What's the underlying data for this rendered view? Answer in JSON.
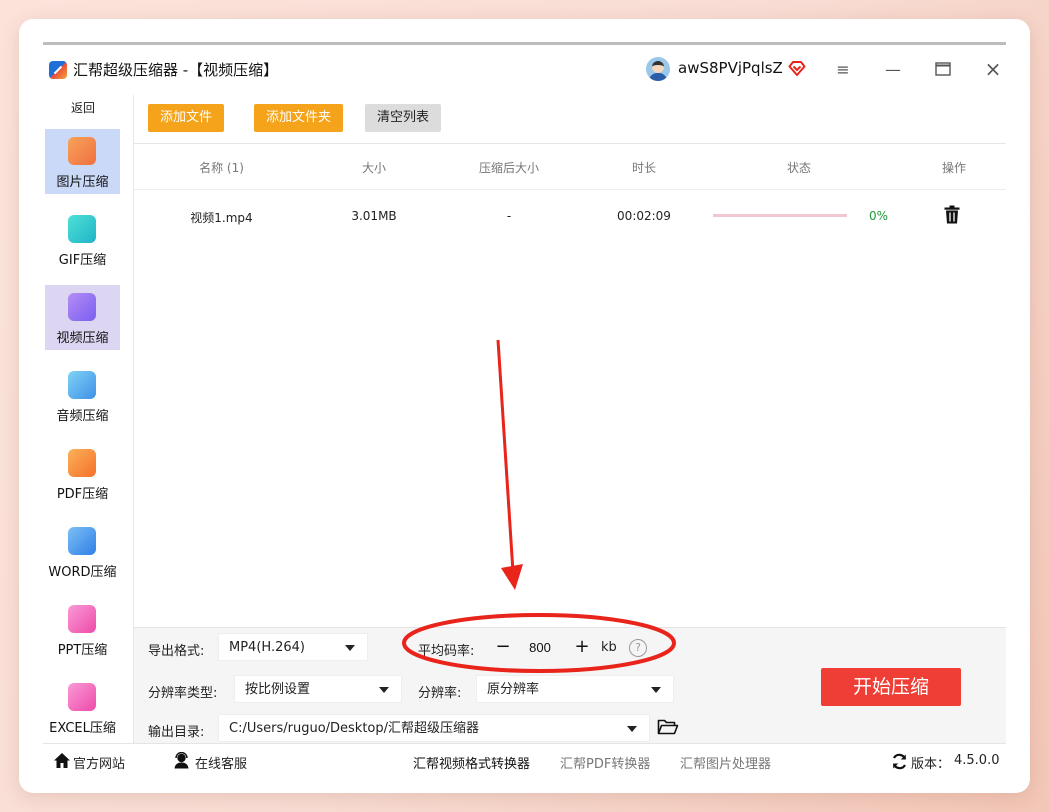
{
  "app": {
    "title": "汇帮超级压缩器  -【视频压缩】",
    "username": "awS8PVjPqlsZ"
  },
  "window_controls": {
    "menu": "≡",
    "minimize": "—",
    "maximize": "□",
    "close": "×"
  },
  "sidebar": {
    "back": "返回",
    "items": [
      {
        "label": "图片压缩",
        "icon": "image-icon",
        "color": "#f0703f"
      },
      {
        "label": "GIF压缩",
        "icon": "gif-icon",
        "color": "#27c8c8"
      },
      {
        "label": "视频压缩",
        "icon": "video-icon",
        "color": "#8a6ef0"
      },
      {
        "label": "音频压缩",
        "icon": "audio-icon",
        "color": "#3fa6ea"
      },
      {
        "label": "PDF压缩",
        "icon": "pdf-icon",
        "color": "#f5852a"
      },
      {
        "label": "WORD压缩",
        "icon": "word-icon",
        "color": "#3d8fe8"
      },
      {
        "label": "PPT压缩",
        "icon": "ppt-icon",
        "color": "#f258b4"
      },
      {
        "label": "EXCEL压缩",
        "icon": "excel-icon",
        "color": "#f258b4"
      }
    ]
  },
  "toolbar": {
    "add_file": "添加文件",
    "add_folder": "添加文件夹",
    "clear_list": "清空列表"
  },
  "table": {
    "headers": [
      "名称 (1)",
      "大小",
      "压缩后大小",
      "时长",
      "状态",
      "操作"
    ],
    "rows": [
      {
        "name": "视频1.mp4",
        "size": "3.01MB",
        "compressed_size": "-",
        "duration": "00:02:09",
        "progress": 0,
        "status": "0%"
      }
    ]
  },
  "settings": {
    "format_label": "导出格式:",
    "format_value": "MP4(H.264)",
    "bitrate_label": "平均码率:",
    "bitrate_minus": "−",
    "bitrate_value": "800",
    "bitrate_plus": "+",
    "bitrate_unit": "kb",
    "help": "?",
    "res_type_label": "分辨率类型:",
    "res_type_value": "按比例设置",
    "res_label": "分辨率:",
    "res_value": "原分辨率",
    "output_label": "输出目录:",
    "output_value": "C:/Users/ruguo/Desktop/汇帮超级压缩器",
    "start": "开始压缩"
  },
  "footer": {
    "website": "官方网站",
    "support": "在线客服",
    "link1": "汇帮视频格式转换器",
    "link2": "汇帮PDF转换器",
    "link3": "汇帮图片处理器",
    "version_label": "版本：",
    "version": "4.5.0.0"
  },
  "colors": {
    "accent_orange": "#f5a31a",
    "start_red": "#ef3e35",
    "annotation_red": "#e8241b",
    "progress_green": "#1e9a3a"
  }
}
